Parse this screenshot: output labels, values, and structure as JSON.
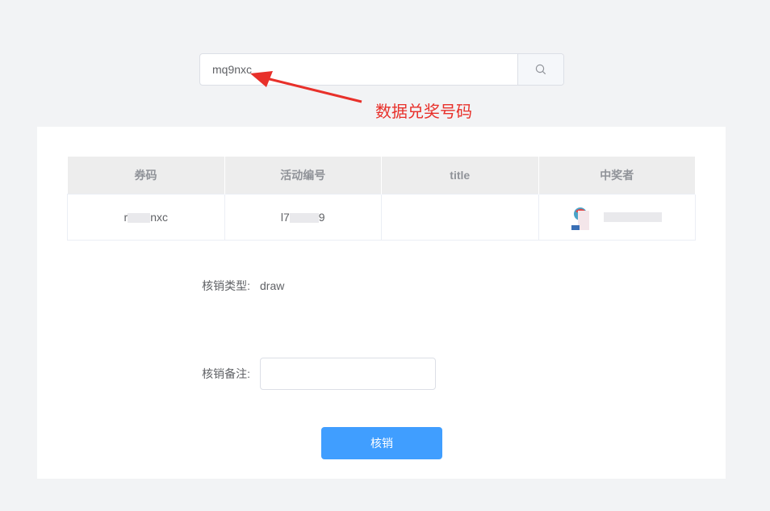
{
  "search": {
    "value": "mq9nxc"
  },
  "annotation": {
    "label": "数据兑奖号码",
    "color": "#e8302a"
  },
  "table": {
    "headers": [
      "券码",
      "活动编号",
      "title",
      "中奖者"
    ],
    "row": {
      "code_prefix": "r",
      "code_suffix": "nxc",
      "activity_prefix": "l7",
      "activity_suffix": "9",
      "title": ""
    }
  },
  "form": {
    "type_label": "核销类型:",
    "type_value": "draw",
    "remark_label": "核销备注:",
    "remark_value": ""
  },
  "submit": {
    "label": "核销"
  },
  "colors": {
    "primary": "#409eff",
    "page_bg": "#f2f3f5"
  }
}
